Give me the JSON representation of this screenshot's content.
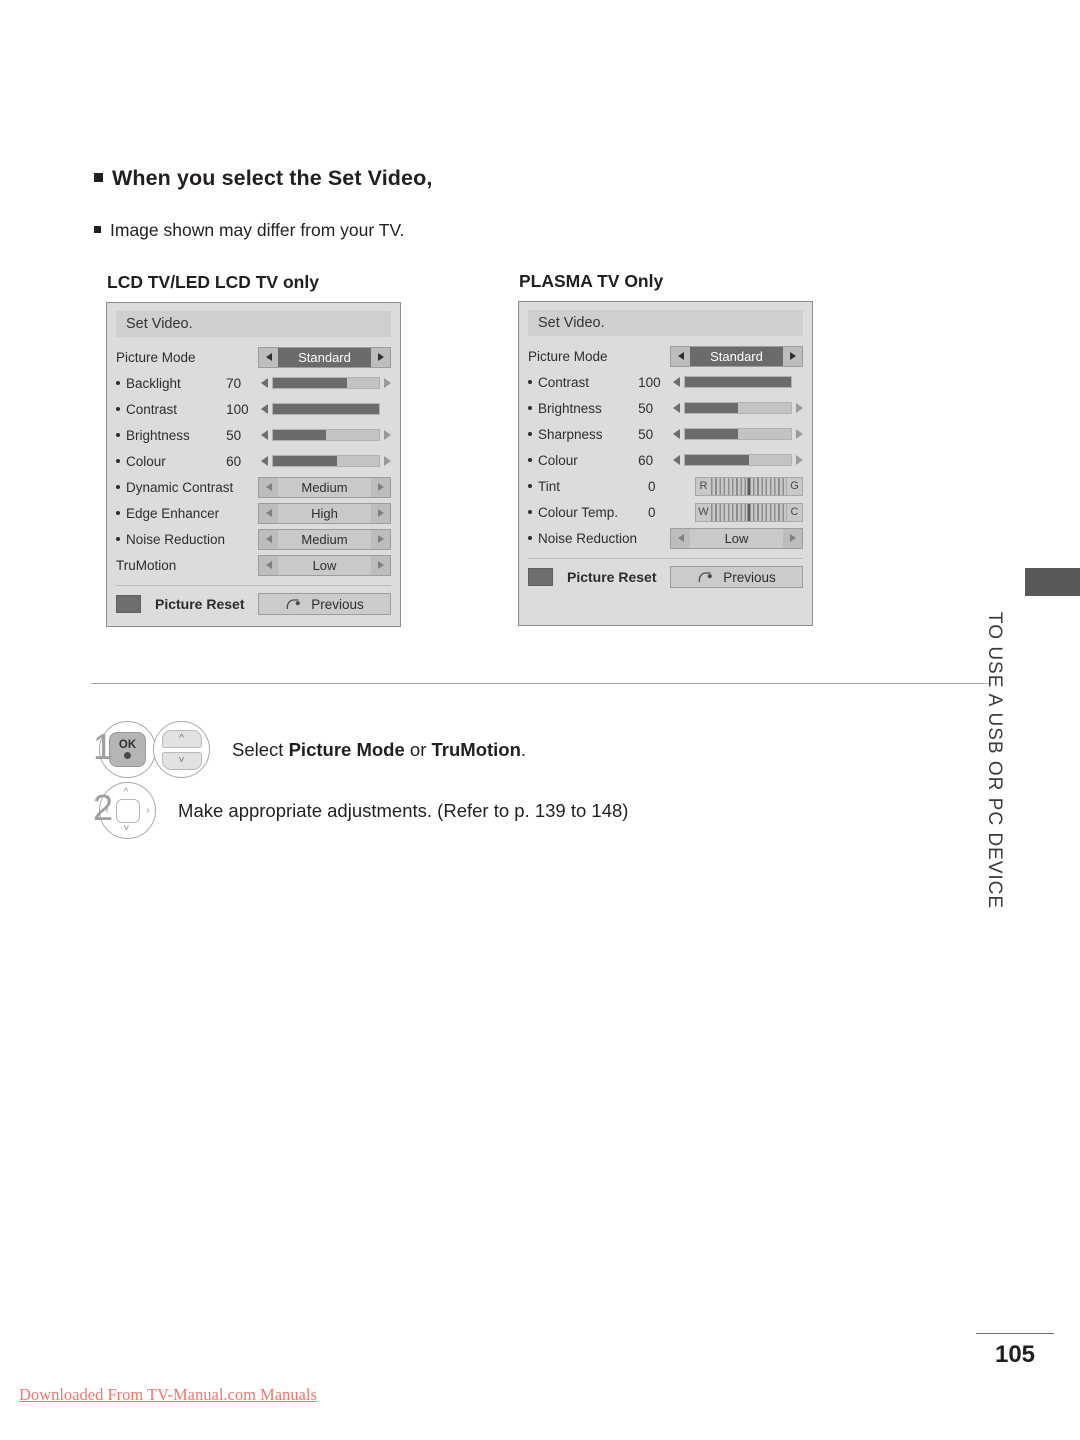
{
  "section": {
    "title": "When you select the Set Video,",
    "note": "Image shown may differ from your TV."
  },
  "columns": {
    "lcd_heading": "LCD TV/LED LCD TV only",
    "plasma_heading": "PLASMA TV Only"
  },
  "osd_lcd": {
    "title": "Set Video.",
    "rows": [
      {
        "label": "Picture Mode",
        "bullet": false,
        "value": "",
        "control": "select",
        "option": "Standard",
        "highlight": true
      },
      {
        "label": "Backlight",
        "bullet": true,
        "value": "70",
        "control": "slider",
        "fill": 70,
        "right_arrow": true
      },
      {
        "label": "Contrast",
        "bullet": true,
        "value": "100",
        "control": "slider",
        "fill": 100,
        "right_arrow": false
      },
      {
        "label": "Brightness",
        "bullet": true,
        "value": "50",
        "control": "slider",
        "fill": 50,
        "right_arrow": true
      },
      {
        "label": "Colour",
        "bullet": true,
        "value": "60",
        "control": "slider",
        "fill": 60,
        "right_arrow": true
      },
      {
        "label": "Dynamic Contrast",
        "bullet": true,
        "value": "",
        "control": "select",
        "option": "Medium",
        "highlight": false
      },
      {
        "label": "Edge Enhancer",
        "bullet": true,
        "value": "",
        "control": "select",
        "option": "High",
        "highlight": false
      },
      {
        "label": "Noise Reduction",
        "bullet": true,
        "value": "",
        "control": "select",
        "option": "Medium",
        "highlight": false
      },
      {
        "label": "TruMotion",
        "bullet": false,
        "value": "",
        "control": "select",
        "option": "Low",
        "highlight": false
      }
    ],
    "reset_label": "Picture Reset",
    "previous_label": "Previous"
  },
  "osd_plasma": {
    "title": "Set Video.",
    "rows": [
      {
        "label": "Picture Mode",
        "bullet": false,
        "value": "",
        "control": "select",
        "option": "Standard",
        "highlight": true
      },
      {
        "label": "Contrast",
        "bullet": true,
        "value": "100",
        "control": "slider",
        "fill": 100,
        "right_arrow": false
      },
      {
        "label": "Brightness",
        "bullet": true,
        "value": "50",
        "control": "slider",
        "fill": 50,
        "right_arrow": true
      },
      {
        "label": "Sharpness",
        "bullet": true,
        "value": "50",
        "control": "slider",
        "fill": 50,
        "right_arrow": true
      },
      {
        "label": "Colour",
        "bullet": true,
        "value": "60",
        "control": "slider",
        "fill": 60,
        "right_arrow": true
      },
      {
        "label": "Tint",
        "bullet": true,
        "value": "0",
        "control": "tickbar",
        "left_cap": "R",
        "right_cap": "G"
      },
      {
        "label": "Colour Temp.",
        "bullet": true,
        "value": "0",
        "control": "tickbar",
        "left_cap": "W",
        "right_cap": "C"
      },
      {
        "label": "Noise Reduction",
        "bullet": true,
        "value": "",
        "control": "select",
        "option": "Low",
        "highlight": false
      }
    ],
    "reset_label": "Picture Reset",
    "previous_label": "Previous"
  },
  "steps": [
    {
      "number": "1",
      "ok_label": "OK",
      "text_prefix": "Select ",
      "text_bold1": "Picture Mode",
      "text_mid": " or ",
      "text_bold2": "TruMotion",
      "text_suffix": "."
    },
    {
      "number": "2",
      "text": "Make appropriate adjustments. (Refer to p. 139 to 148)"
    }
  ],
  "side_tab_text": "TO USE A USB OR PC DEVICE",
  "page_number": "105",
  "footer_note": "Downloaded From TV-Manual.com Manuals",
  "colors": {
    "osd_background": "#dcdcdc",
    "osd_title_bar": "#cfcfcf",
    "slider_fill": "#6b6b6b",
    "slider_track": "#c3c3c3",
    "highlight": "#6b6b6b",
    "side_tab": "#58595b",
    "footer_red": "#f4756e"
  }
}
